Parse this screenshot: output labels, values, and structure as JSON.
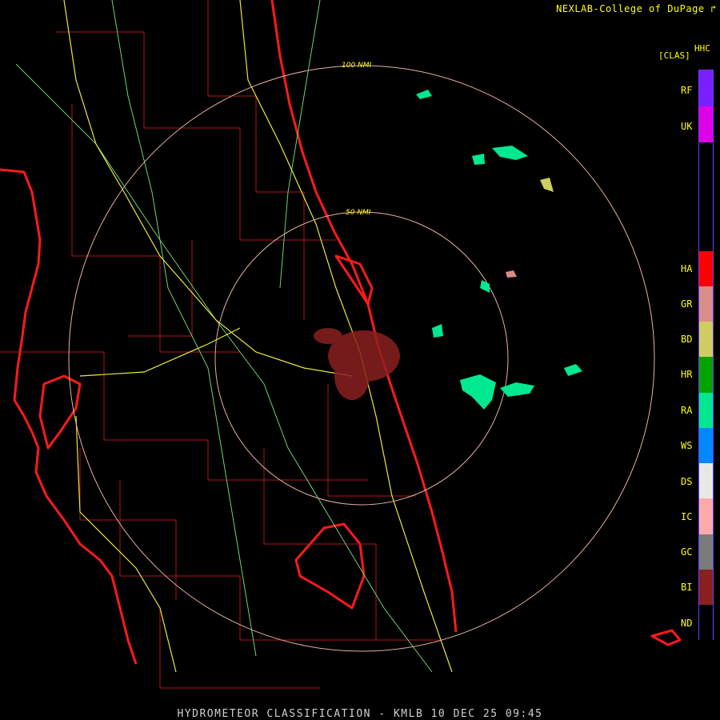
{
  "credit": "NEXLAB-College of DuPage",
  "legend": {
    "header_top": "HHC",
    "header_bottom": "[CLAS]",
    "classes": [
      {
        "code": "RF",
        "color": "#7a1fff"
      },
      {
        "code": "UK",
        "color": "#e000e8"
      },
      {
        "code": "HA",
        "color": "#ff0000"
      },
      {
        "code": "GR",
        "color": "#d98c8c"
      },
      {
        "code": "BD",
        "color": "#cfcc60"
      },
      {
        "code": "HR",
        "color": "#00a400"
      },
      {
        "code": "RA",
        "color": "#00e890"
      },
      {
        "code": "WS",
        "color": "#0088ff"
      },
      {
        "code": "DS",
        "color": "#e8e8e8"
      },
      {
        "code": "IC",
        "color": "#ffaaaa"
      },
      {
        "code": "GC",
        "color": "#7a7a7a"
      },
      {
        "code": "BI",
        "color": "#8a2020"
      },
      {
        "code": "ND",
        "color": "#000000"
      }
    ]
  },
  "rings": {
    "inner_label": "50 NMI",
    "outer_label": "100 NMI"
  },
  "footer": "HYDROMETEOR CLASSIFICATION - KMLB 10 DEC 25 09:45"
}
